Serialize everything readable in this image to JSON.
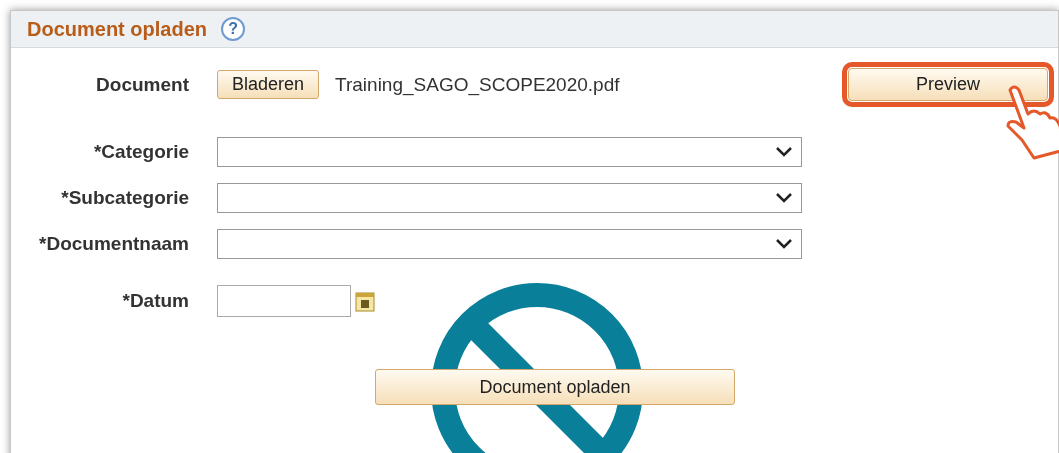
{
  "panel": {
    "title": "Document opladen",
    "help": "?"
  },
  "document": {
    "label": "Document",
    "browse_button": "Bladeren",
    "filename": "Training_SAGO_SCOPE2020.pdf",
    "preview_button": "Preview",
    "preview_highlighted": true
  },
  "fields": [
    {
      "kind": "select",
      "label": "*Categorie"
    },
    {
      "kind": "select",
      "label": "*Subcategorie"
    },
    {
      "kind": "select",
      "label": "*Documentnaam"
    },
    {
      "kind": "date",
      "label": "*Datum"
    }
  ],
  "submit_button": "Document opladen",
  "submit_prohibited": true
}
